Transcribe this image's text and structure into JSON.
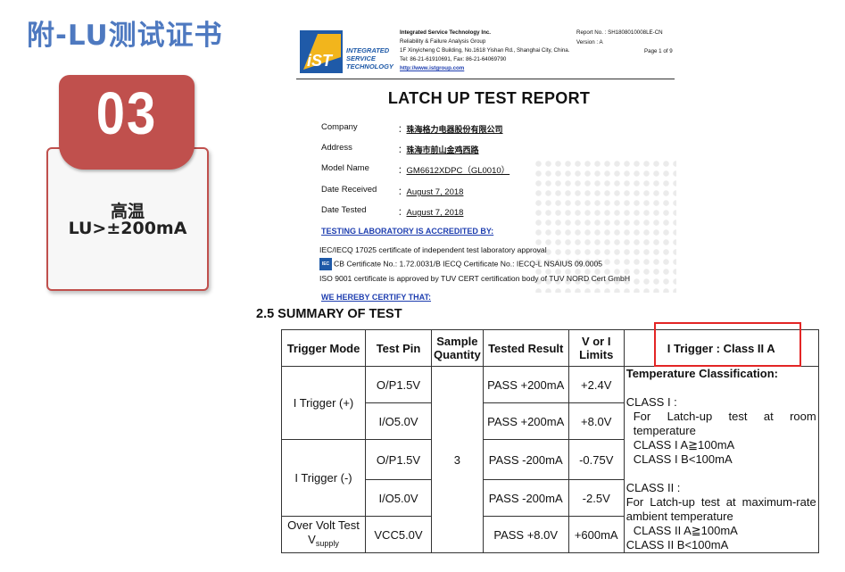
{
  "page_title": "附-LU测试证书",
  "badge": {
    "number": "03",
    "line1": "高温",
    "line2": "LU>±200mA"
  },
  "report": {
    "logo_text": [
      "INTEGRATED",
      "SERVICE",
      "TECHNOLOGY"
    ],
    "logo_mark": "iST",
    "company_name": "Integrated Service Technology Inc.",
    "company_dept": "Reliability & Failure Analysis Group",
    "company_address": "1F Xinyicheng C Building, No.1618 Yishan Rd., Shanghai City, China.",
    "company_tel": "Tel: 86-21-61910691, Fax: 86-21-64069790",
    "company_url": "http://www.istgroup.com",
    "report_no": "Report No. : SH1808010008LE-CN",
    "version": "Version : A",
    "page": "Page 1 of 9",
    "title": "LATCH UP TEST REPORT",
    "fields": [
      {
        "label": "Company",
        "value": "珠海格力电器股份有限公司"
      },
      {
        "label": "Address",
        "value": "珠海市前山金鸡西路"
      },
      {
        "label": "Model Name",
        "value": "GM6612XDPC（GL0010）"
      },
      {
        "label": "Date Received",
        "value": "August 7, 2018"
      },
      {
        "label": "Date Tested",
        "value": "August 7, 2018"
      }
    ],
    "accredited_heading": "TESTING LABORATORY IS ACCREDITED BY:",
    "cert_line1": "IEC/IECQ 17025 certificate of independent test laboratory approval",
    "iec_logo": "IEC",
    "cert_line2": "CB Certificate No.: 1.72.0031/B     IECQ Certificate No.: IECQ-L NSAIUS 09.0005",
    "cert_line3": "ISO 9001 certificate is approved by TUV CERT certification body of TUV NORD Cert GmbH",
    "certify_heading": "WE HEREBY CERTIFY THAT:"
  },
  "summary": {
    "title": "2.5 SUMMARY OF TEST",
    "headers": {
      "trigger_mode": "Trigger Mode",
      "test_pin": "Test Pin",
      "sample_quantity": "Sample Quantity",
      "tested_result": "Tested Result",
      "v_or_i_limits": "V or I Limits",
      "class_header": "I Trigger   : Class  II A"
    },
    "sample_quantity_value": "3",
    "rows": [
      {
        "mode": "I Trigger (+)",
        "pin": "O/P1.5V",
        "result": "PASS +200mA",
        "limit": "+2.4V"
      },
      {
        "mode": "",
        "pin": "I/O5.0V",
        "result": "PASS +200mA",
        "limit": "+8.0V"
      },
      {
        "mode": "I Trigger (-)",
        "pin": "O/P1.5V",
        "result": "PASS -200mA",
        "limit": "-0.75V"
      },
      {
        "mode": "",
        "pin": "I/O5.0V",
        "result": "PASS -200mA",
        "limit": "-2.5V"
      },
      {
        "mode": "Over Volt Test",
        "mode_sub_main": "V",
        "mode_sub": "supply",
        "pin": "VCC5.0V",
        "result": "PASS +8.0V",
        "limit": "+600mA"
      }
    ],
    "classification": {
      "heading": "Temperature Classification:",
      "class1": "CLASS I :",
      "class1_desc": "For   Latch-up   test   at   room temperature",
      "class1a": "CLASS I A≧100mA",
      "class1b": "CLASS I B<100mA",
      "class2": "CLASS II :",
      "class2_desc": "For Latch-up test at maximum-rate ambient temperature",
      "class2a": "CLASS II A≧100mA",
      "class2b": "CLASS II B<100mA"
    }
  }
}
